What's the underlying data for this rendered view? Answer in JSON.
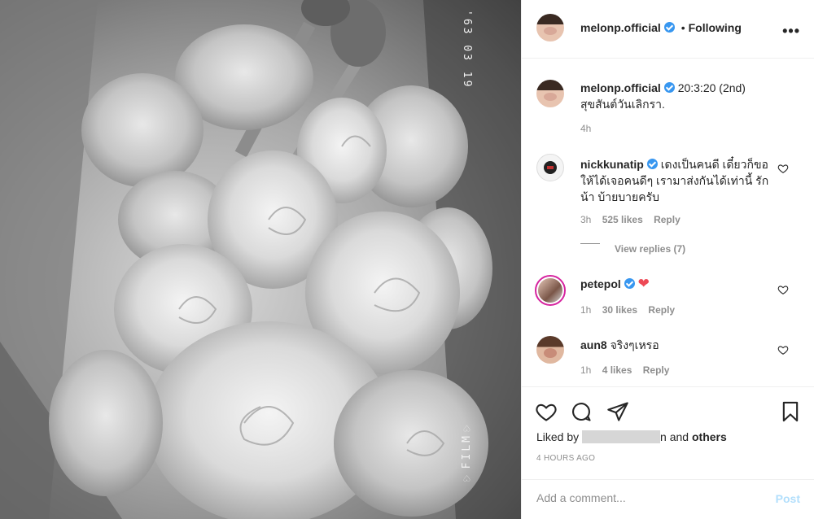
{
  "post": {
    "photo_alt": "black and white bouquet of roses",
    "date_stamp": "'63 03 19",
    "film_stamp": "♡FILM♡"
  },
  "header": {
    "username": "melonp.official",
    "separator": "•",
    "follow_label": "Following",
    "more_label": "•••"
  },
  "caption": {
    "username": "melonp.official",
    "text": "20:3:20 (2nd)",
    "text_line2": "สุขสันต์วันเลิกรา.",
    "time": "4h"
  },
  "comments": [
    {
      "username": "nickkunatip",
      "text": "เดงเป็นคนดี เดี๋ยวก็ขอให้ได้เจอคนดีๆ เรามาส่งกันได้เท่านี้ รักน้า บ้ายบายครับ",
      "time": "3h",
      "likes": "525 likes",
      "reply": "Reply",
      "view_replies": "View replies (7)"
    },
    {
      "username": "petepol",
      "text": "❤",
      "time": "1h",
      "likes": "30 likes",
      "reply": "Reply"
    },
    {
      "username": "aun8",
      "text": "จริงๆเหรอ",
      "time": "1h",
      "likes": "4 likes",
      "reply": "Reply"
    }
  ],
  "engagement": {
    "liked_by_prefix": "Liked by",
    "liked_by_suffix": "n and",
    "others_label": "others",
    "timestamp": "4 HOURS AGO"
  },
  "comment_box": {
    "placeholder": "Add a comment...",
    "post_label": "Post"
  },
  "colors": {
    "verified": "#3897f0",
    "heart": "#ed4956",
    "post_disabled": "#b2dffc",
    "muted": "#8e8e8e"
  }
}
